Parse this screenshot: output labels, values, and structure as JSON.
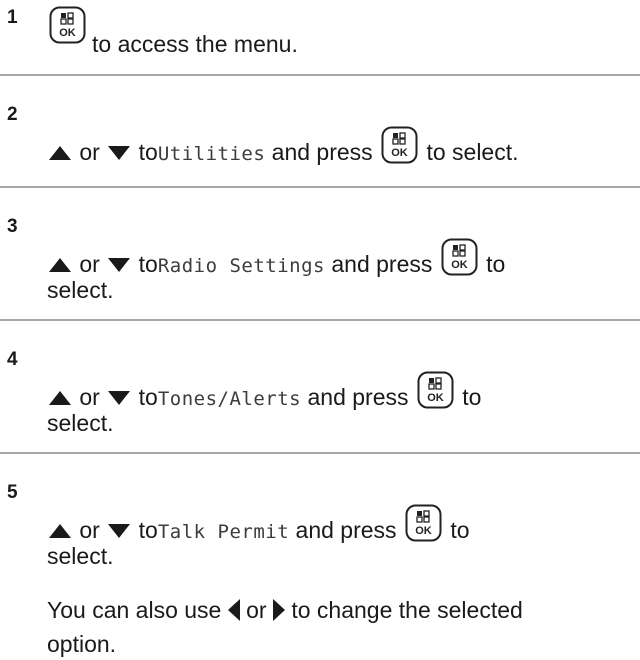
{
  "steps": [
    {
      "number": "1",
      "after_ok": "to access the menu."
    },
    {
      "number": "2",
      "or": "or",
      "to": "to",
      "menu_item": "Utilities",
      "and_press": "and press",
      "suffix": "to select."
    },
    {
      "number": "3",
      "or": "or",
      "to": "to",
      "menu_item": "Radio Settings",
      "and_press": "and press",
      "suffix": "to",
      "suffix2": "select."
    },
    {
      "number": "4",
      "or": "or",
      "to": "to",
      "menu_item": "Tones/Alerts",
      "and_press": "and press",
      "suffix": "to",
      "suffix2": "select."
    },
    {
      "number": "5",
      "or": "or",
      "to": "to",
      "menu_item": "Talk Permit",
      "and_press": "and press",
      "suffix": "to",
      "suffix2": "select."
    }
  ],
  "note": {
    "prefix": "You can also use",
    "or": "or",
    "suffix": "to change the selected",
    "suffix2": "option."
  },
  "icons": {
    "ok_button": "menu-ok-button-icon",
    "up": "up-arrow-icon",
    "down": "down-arrow-icon",
    "left": "left-arrow-icon",
    "right": "right-arrow-icon"
  }
}
